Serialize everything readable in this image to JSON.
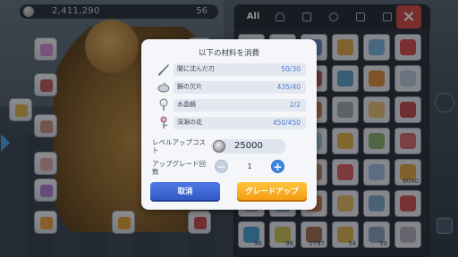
{
  "top_bar": {
    "zeny": "2,411,290",
    "count": "56"
  },
  "inventory": {
    "tabs": [
      {
        "label": "All",
        "icon": "all-text"
      },
      {
        "label": "",
        "icon": "heart-icon"
      },
      {
        "label": "",
        "icon": "shirt-icon"
      },
      {
        "label": "",
        "icon": "potion-icon"
      },
      {
        "label": "",
        "icon": "scroll-icon"
      },
      {
        "label": "",
        "icon": "card-icon"
      }
    ],
    "close_label": "×",
    "quantities": [
      "",
      "",
      "",
      "",
      "",
      "",
      "",
      "",
      "",
      "",
      "",
      "",
      "",
      "",
      "",
      "",
      "",
      "",
      "",
      "",
      "",
      "",
      "",
      "",
      "180",
      "",
      "",
      "",
      "",
      "6040",
      "",
      "",
      "",
      "",
      "",
      "",
      "96",
      "98",
      "1797",
      "54",
      "99",
      ""
    ]
  },
  "dialog": {
    "title": "以下の材料を消費",
    "materials": [
      {
        "name": "闇に沈んだ刃",
        "count": "50/30",
        "icon": "blade-icon"
      },
      {
        "name": "鏡の欠片",
        "count": "435/40",
        "icon": "mirror-shard-icon"
      },
      {
        "name": "水晶鏡",
        "count": "2/2",
        "icon": "crystal-mirror-icon"
      },
      {
        "name": "深淵の花",
        "count": "450/450",
        "icon": "abyss-flower-icon"
      }
    ],
    "cost_label": "レベルアップコスト",
    "cost_value": "25000",
    "upgrade_count_label": "アップグレード回数",
    "upgrade_count_value": "1",
    "minus_label": "−",
    "plus_label": "+",
    "cancel_label": "取消",
    "upgrade_label": "グレードアップ"
  }
}
